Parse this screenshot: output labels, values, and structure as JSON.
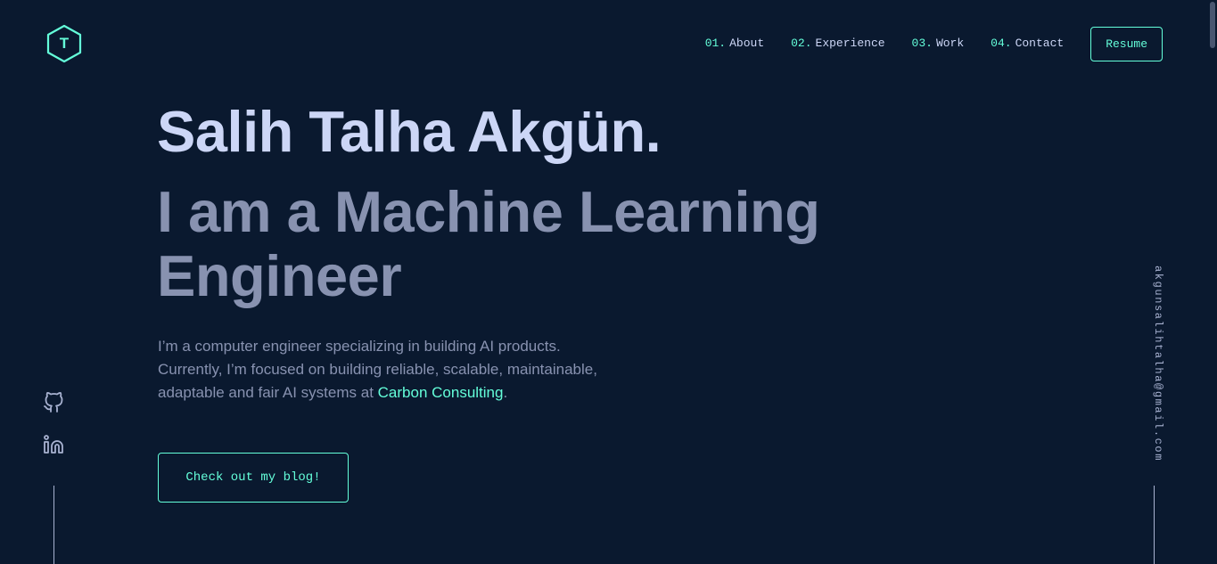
{
  "logo": {
    "letter": "T",
    "icon": "hexagon-logo-icon"
  },
  "nav": {
    "items": [
      {
        "num": "01.",
        "label": "About"
      },
      {
        "num": "02.",
        "label": "Experience"
      },
      {
        "num": "03.",
        "label": "Work"
      },
      {
        "num": "04.",
        "label": "Contact"
      }
    ],
    "resume_label": "Resume"
  },
  "hero": {
    "name": "Salih Talha Akgün.",
    "role": "I am a Machine Learning Engineer",
    "desc_part1": "I’m a computer engineer specializing in building AI products. Currently, I’m focused on building reliable, scalable, maintainable, adaptable and fair AI systems at ",
    "desc_link": "Carbon Consulting",
    "desc_part2": ".",
    "cta_label": "Check out my blog!"
  },
  "social": {
    "items": [
      {
        "icon": "github-icon"
      },
      {
        "icon": "linkedin-icon"
      }
    ]
  },
  "email": "akgunsalihtalha@gmail.com",
  "colors": {
    "background": "#0a192f",
    "accent": "#64ffda",
    "heading": "#ccd6f6",
    "text": "#8892b0",
    "light": "#a8b2d1"
  }
}
